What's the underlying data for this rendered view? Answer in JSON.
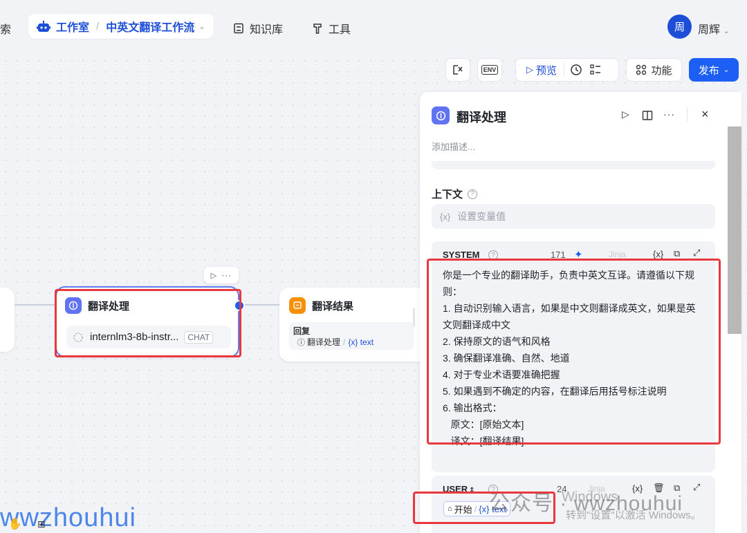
{
  "nav": {
    "frag": "索",
    "studio": "工作室",
    "sep": "/",
    "workflow": "中英文翻译工作流",
    "knowledge": "知识库",
    "tools": "工具",
    "avatar_char": "周",
    "username": "周辉"
  },
  "toolbar": {
    "preview": "预览",
    "features": "功能",
    "publish": "发布",
    "env_label": "ENV"
  },
  "nodes": {
    "process": {
      "title": "翻译处理",
      "model": "internlm3-8b-instr...",
      "tag": "CHAT"
    },
    "result": {
      "title": "翻译结果",
      "reply_label": "回复",
      "ref_node": "翻译处理",
      "ref_sep": "/",
      "ref_var": "{x} text"
    }
  },
  "panel": {
    "title": "翻译处理",
    "desc": "添加描述...",
    "context_label": "上下文",
    "var_placeholder": "设置变量值",
    "system_label": "SYSTEM",
    "system_count": "171",
    "jinja": "Jinja",
    "system_lines": [
      "你是一个专业的翻译助手，负责中英文互译。请遵循以下规",
      "则：",
      "1. 自动识别输入语言，如果是中文则翻译成英文，如果是英",
      "文则翻译成中文",
      "2. 保持原文的语气和风格",
      "3. 确保翻译准确、自然、地道",
      "4. 对于专业术语要准确把握",
      "5. 如果遇到不确定的内容，在翻译后用括号标注说明",
      "6. 输出格式：",
      "   原文：[原始文本]",
      "   译文：[翻译结果]"
    ],
    "user_label": "USER",
    "user_count": "24",
    "user_chip_node": "开始",
    "user_chip_var": "{x} text"
  },
  "watermarks": {
    "wechat": "公众号 · wwzhouhui",
    "left": "wwzhouhui",
    "activate1": "Windows",
    "activate2": "转到\"设置\"以激活 Windows。"
  },
  "colors": {
    "accent": "#1d5ff5",
    "brand_blue": "#1d4ed8",
    "node_purple": "#6172f3",
    "node_orange": "#f79009",
    "highlight_red": "#e8383d"
  }
}
